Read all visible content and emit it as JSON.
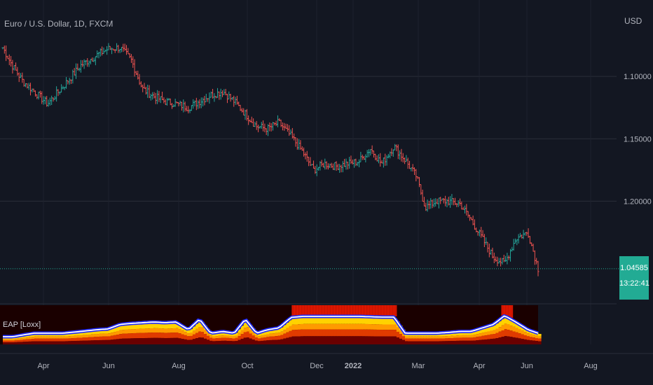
{
  "header": {
    "symbol_title": "Euro / U.S. Dollar, 1D, FXCM",
    "currency": "USD"
  },
  "price_axis": {
    "labels": [
      "1.20000",
      "1.15000",
      "1.10000"
    ],
    "last_price": "1.04585",
    "countdown": "13:22:41"
  },
  "time_axis": {
    "labels": [
      "Apr",
      "Jun",
      "Aug",
      "Oct",
      "Dec",
      "2022",
      "Mar",
      "Apr",
      "Jun",
      "Aug"
    ]
  },
  "indicator": {
    "label": "EAP [Loxx]"
  },
  "colors": {
    "background": "#131722",
    "up": "#26a69a",
    "down": "#ef5350",
    "grid": "#2a2e39",
    "last_price": "#22ab94",
    "indicator_line": "#ffffff",
    "indicator_glow": "#1f2bff"
  },
  "chart_data": {
    "type": "line",
    "x": [
      "2021-02-20",
      "2021-03-01",
      "2021-03-10",
      "2021-03-20",
      "2021-04-01",
      "2021-04-15",
      "2021-05-01",
      "2021-05-15",
      "2021-05-25",
      "2021-06-05",
      "2021-06-15",
      "2021-06-25",
      "2021-07-05",
      "2021-07-15",
      "2021-07-25",
      "2021-08-05",
      "2021-08-15",
      "2021-08-25",
      "2021-09-05",
      "2021-09-15",
      "2021-09-25",
      "2021-10-05",
      "2021-10-15",
      "2021-10-25",
      "2021-11-05",
      "2021-11-15",
      "2021-11-25",
      "2021-12-05",
      "2021-12-15",
      "2021-12-25",
      "2022-01-05",
      "2022-01-15",
      "2022-01-25",
      "2022-02-05",
      "2022-02-15",
      "2022-02-25",
      "2022-03-05",
      "2022-03-15",
      "2022-03-25",
      "2022-04-05",
      "2022-04-15",
      "2022-04-25",
      "2022-05-05",
      "2022-05-15",
      "2022-05-25",
      "2022-06-05",
      "2022-06-14"
    ],
    "series": [
      {
        "values": [
          1.223,
          1.208,
          1.196,
          1.188,
          1.178,
          1.192,
          1.209,
          1.217,
          1.222,
          1.223,
          1.213,
          1.19,
          1.184,
          1.18,
          1.178,
          1.175,
          1.18,
          1.185,
          1.188,
          1.18,
          1.17,
          1.16,
          1.158,
          1.163,
          1.152,
          1.14,
          1.125,
          1.13,
          1.128,
          1.13,
          1.132,
          1.142,
          1.13,
          1.144,
          1.133,
          1.12,
          1.095,
          1.1,
          1.1,
          1.098,
          1.085,
          1.07,
          1.055,
          1.05,
          1.07,
          1.075,
          1.046
        ]
      }
    ],
    "ylim": [
      1.02,
      1.25
    ],
    "y_ticks": [
      1.1,
      1.15,
      1.2
    ],
    "last_value": 1.04585,
    "grid": true,
    "indicator_series": {
      "values": [
        0.2,
        0.2,
        0.25,
        0.3,
        0.3,
        0.3,
        0.35,
        0.4,
        0.42,
        0.55,
        0.58,
        0.6,
        0.62,
        0.6,
        0.62,
        0.4,
        0.7,
        0.3,
        0.35,
        0.3,
        0.7,
        0.3,
        0.4,
        0.45,
        0.75,
        0.78,
        0.78,
        0.78,
        0.78,
        0.78,
        0.78,
        0.77,
        0.76,
        0.76,
        0.3,
        0.3,
        0.3,
        0.3,
        0.32,
        0.35,
        0.35,
        0.45,
        0.55,
        0.8,
        0.62,
        0.4,
        0.3
      ],
      "ylim": [
        0,
        1
      ]
    }
  }
}
